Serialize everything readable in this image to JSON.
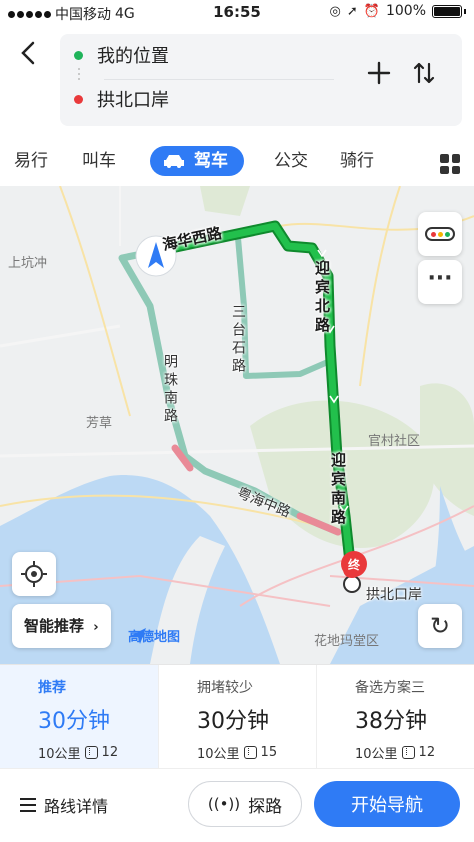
{
  "status_bar": {
    "carrier": "中国移动",
    "network": "4G",
    "time": "16:55",
    "battery": "100%"
  },
  "route": {
    "origin": "我的位置",
    "destination": "拱北口岸",
    "add_icon": "plus-icon",
    "swap_icon": "swap-icon"
  },
  "tabs": [
    {
      "label": "易行"
    },
    {
      "label": "叫车"
    },
    {
      "label": "驾车"
    },
    {
      "label": "公交"
    },
    {
      "label": "骑行"
    }
  ],
  "map": {
    "places": {
      "shangkengchong": "上坑冲",
      "fangcao": "芳草",
      "guancun": "官村社区",
      "huadimatang": "花地玛堂区"
    },
    "roads": {
      "haihua_west": "海华西路",
      "yingbin_north": "迎宾北路",
      "sanhe_shi": "三台石路",
      "mingzhu_south": "明珠南路",
      "yuehai_middle": "粤海中路",
      "yingbin_south": "迎宾南路"
    },
    "destination_badge": "终",
    "destination_label": "拱北口岸",
    "smart_button": "智能推荐",
    "logo_text": "高德地图",
    "colors": {
      "route_primary": "#1fb545",
      "route_alt": "#8ec9b6",
      "congestion": "#e98a97",
      "traffic_red": "#e9393b",
      "traffic_yellow": "#f7b500",
      "traffic_green": "#1fb35a"
    }
  },
  "options": [
    {
      "tag": "推荐",
      "time": "30分钟",
      "distance": "10公里",
      "lights": "12"
    },
    {
      "tag": "拥堵较少",
      "time": "30分钟",
      "distance": "10公里",
      "lights": "15"
    },
    {
      "tag": "备选方案三",
      "time": "38分钟",
      "distance": "10公里",
      "lights": "12"
    }
  ],
  "bottom": {
    "details": "路线详情",
    "explore": "探路",
    "navigate": "开始导航"
  }
}
